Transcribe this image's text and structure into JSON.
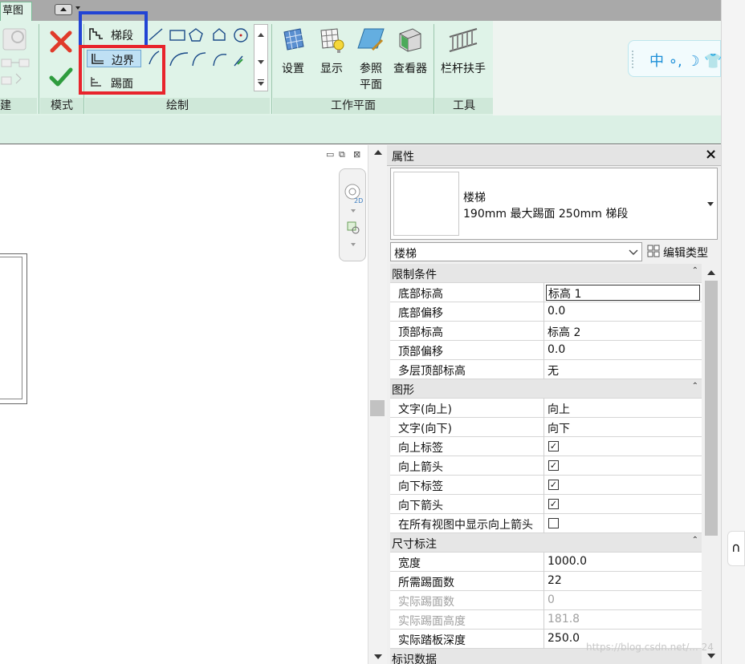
{
  "ribbon": {
    "active_tab": "草图",
    "panels": {
      "create": "建",
      "mode": "模式",
      "draw": "绘制",
      "work_plane": "工作平面",
      "tools": "工具"
    },
    "draw_tools": {
      "run": "梯段",
      "boundary": "边界",
      "riser": "踢面"
    },
    "work_plane_tools": {
      "set": "设置",
      "show": "显示",
      "ref_plane_line1": "参照",
      "ref_plane_line2": "平面",
      "viewer": "查看器"
    },
    "tools_panel": {
      "railing": "栏杆扶手"
    },
    "highlight_colors": {
      "blue": "#2244d4",
      "red": "#e8242c"
    }
  },
  "ime_bar": {
    "text": "中 ∘, ☽ 👕"
  },
  "properties": {
    "title": "属性",
    "close": "×",
    "type_family": "楼梯",
    "type_name": "190mm 最大踢面 250mm 梯段",
    "type_selector": "楼梯",
    "edit_type": "编辑类型",
    "groups": [
      {
        "name": "限制条件",
        "rows": [
          {
            "label": "底部标高",
            "value": "标高 1"
          },
          {
            "label": "底部偏移",
            "value": "0.0"
          },
          {
            "label": "顶部标高",
            "value": "标高 2"
          },
          {
            "label": "顶部偏移",
            "value": "0.0"
          },
          {
            "label": "多层顶部标高",
            "value": "无"
          }
        ]
      },
      {
        "name": "图形",
        "rows": [
          {
            "label": "文字(向上)",
            "value": "向上"
          },
          {
            "label": "文字(向下)",
            "value": "向下"
          },
          {
            "label": "向上标签",
            "checked": true
          },
          {
            "label": "向上箭头",
            "checked": true
          },
          {
            "label": "向下标签",
            "checked": true
          },
          {
            "label": "向下箭头",
            "checked": true
          },
          {
            "label": "在所有视图中显示向上箭头",
            "checked": false
          }
        ]
      },
      {
        "name": "尺寸标注",
        "rows": [
          {
            "label": "宽度",
            "value": "1000.0"
          },
          {
            "label": "所需踢面数",
            "value": "22"
          },
          {
            "label": "实际踢面数",
            "value": "0"
          },
          {
            "label": "实际踢面高度",
            "value": "181.8"
          },
          {
            "label": "实际踏板深度",
            "value": "250.0"
          }
        ]
      },
      {
        "name": "标识数据",
        "rows": []
      }
    ]
  },
  "watermark": "https://blog.csdn.net/... 24"
}
